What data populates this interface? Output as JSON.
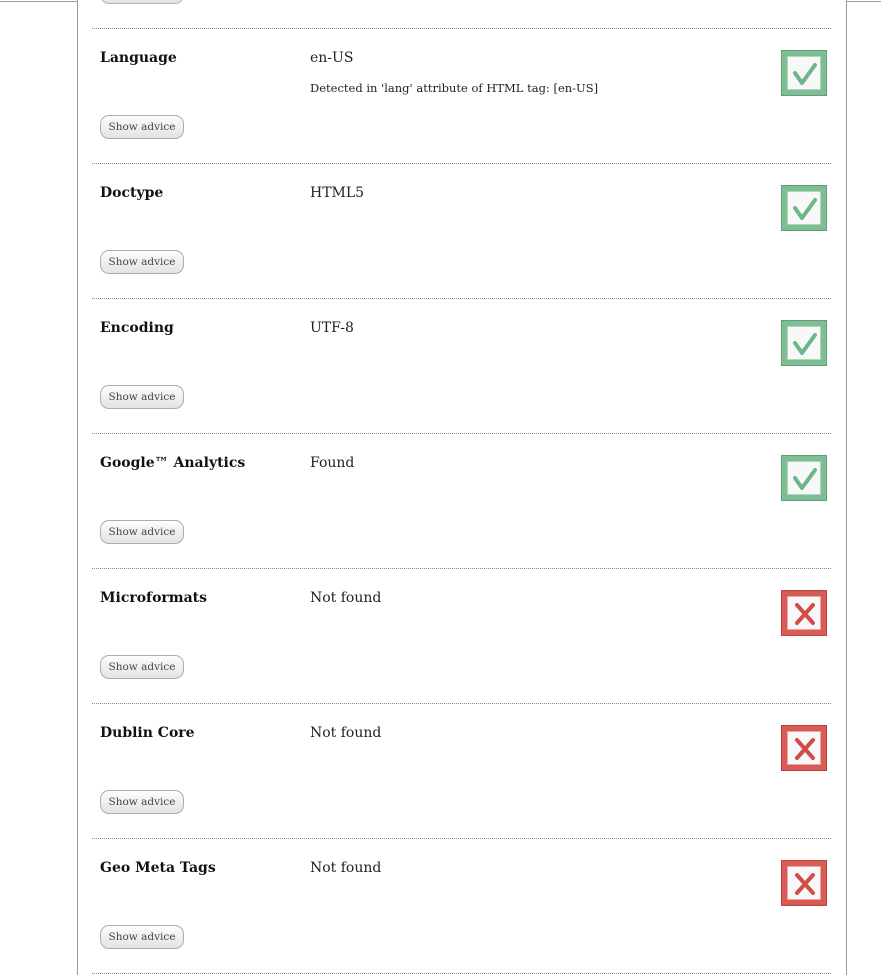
{
  "advice_button_label": "Show advice",
  "colors": {
    "pass": "#7fbe95",
    "pass_mark": "#6db688",
    "fail": "#d85c55",
    "fail_mark": "#cf4f48"
  },
  "checks": [
    {
      "label": "Language",
      "value": "en-US",
      "detail": "Detected in 'lang' attribute of HTML tag: [en-US]",
      "status": "pass",
      "status_icon": "check-icon"
    },
    {
      "label": "Doctype",
      "value": "HTML5",
      "detail": "",
      "status": "pass",
      "status_icon": "check-icon"
    },
    {
      "label": "Encoding",
      "value": "UTF-8",
      "detail": "",
      "status": "pass",
      "status_icon": "check-icon"
    },
    {
      "label": "Google™ Analytics",
      "value": "Found",
      "detail": "",
      "status": "pass",
      "status_icon": "check-icon"
    },
    {
      "label": "Microformats",
      "value": "Not found",
      "detail": "",
      "status": "fail",
      "status_icon": "cross-icon"
    },
    {
      "label": "Dublin Core",
      "value": "Not found",
      "detail": "",
      "status": "fail",
      "status_icon": "cross-icon"
    },
    {
      "label": "Geo Meta Tags",
      "value": "Not found",
      "detail": "",
      "status": "fail",
      "status_icon": "cross-icon"
    }
  ]
}
